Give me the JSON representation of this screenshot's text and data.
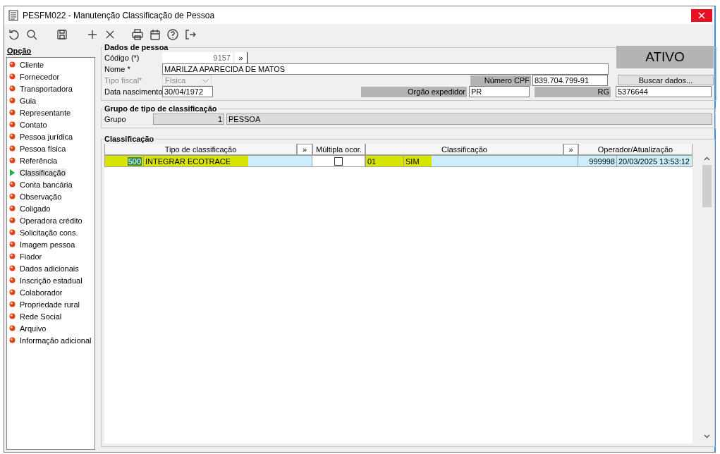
{
  "window": {
    "title": "PESFM022 - Manutenção Classificação de Pessoa"
  },
  "sidebar": {
    "title": "Opção",
    "items": [
      {
        "label": "Cliente",
        "selected": false
      },
      {
        "label": "Fornecedor",
        "selected": false
      },
      {
        "label": "Transportadora",
        "selected": false
      },
      {
        "label": "Guia",
        "selected": false
      },
      {
        "label": "Representante",
        "selected": false
      },
      {
        "label": "Contato",
        "selected": false
      },
      {
        "label": "Pessoa jurídica",
        "selected": false
      },
      {
        "label": "Pessoa física",
        "selected": false
      },
      {
        "label": "Referência",
        "selected": false
      },
      {
        "label": "Classificação",
        "selected": true
      },
      {
        "label": "Conta bancária",
        "selected": false
      },
      {
        "label": "Observação",
        "selected": false
      },
      {
        "label": "Coligado",
        "selected": false
      },
      {
        "label": "Operadora crédito",
        "selected": false
      },
      {
        "label": "Solicitação cons.",
        "selected": false
      },
      {
        "label": "Imagem pessoa",
        "selected": false
      },
      {
        "label": "Fiador",
        "selected": false
      },
      {
        "label": "Dados adicionais",
        "selected": false
      },
      {
        "label": "Inscrição estadual",
        "selected": false
      },
      {
        "label": "Colaborador",
        "selected": false
      },
      {
        "label": "Propriedade rural",
        "selected": false
      },
      {
        "label": "Rede Social",
        "selected": false
      },
      {
        "label": "Arquivo",
        "selected": false
      },
      {
        "label": "Informação adicional",
        "selected": false
      }
    ]
  },
  "person": {
    "title": "Dados de pessoa",
    "codigo": {
      "label": "Código (*)",
      "value": "9157",
      "lookup": "»"
    },
    "nome": {
      "label": "Nome *",
      "value": "MARILZA APARECIDA DE MATOS"
    },
    "tipo_fiscal": {
      "label": "Tipo fiscal*",
      "value": "Física",
      "disabled": true
    },
    "data_nascimento": {
      "label": "Data nascimento",
      "value": "30/04/1972"
    },
    "cpf": {
      "label": "Número CPF",
      "value": "839.704.799-91"
    },
    "orgao": {
      "label": "Orgão expedidor",
      "value": "PR"
    },
    "rg": {
      "label": "RG",
      "value": "5376644"
    },
    "status": "ATIVO",
    "search_button": "Buscar dados..."
  },
  "group": {
    "title": "Grupo de tipo de classificação",
    "label": "Grupo",
    "code": "1",
    "name": "PESSOA"
  },
  "table": {
    "title": "Classificação",
    "columns": [
      {
        "label": "Tipo de classificação",
        "kind": "text"
      },
      {
        "label": "»",
        "kind": "button"
      },
      {
        "label": "Múltipla ocor.",
        "kind": "text"
      },
      {
        "label": "Classificação",
        "kind": "text"
      },
      {
        "label": "»",
        "kind": "button"
      },
      {
        "label": "Operador/Atualização",
        "kind": "text"
      }
    ],
    "rows": [
      {
        "type_code": "500",
        "type_name": "INTEGRAR ECOTRACE",
        "multiple": false,
        "class_code": "01",
        "class_name": "SIM",
        "operator": "999998",
        "updated": "20/03/2025 13:53:12",
        "highlighted": true
      }
    ]
  }
}
